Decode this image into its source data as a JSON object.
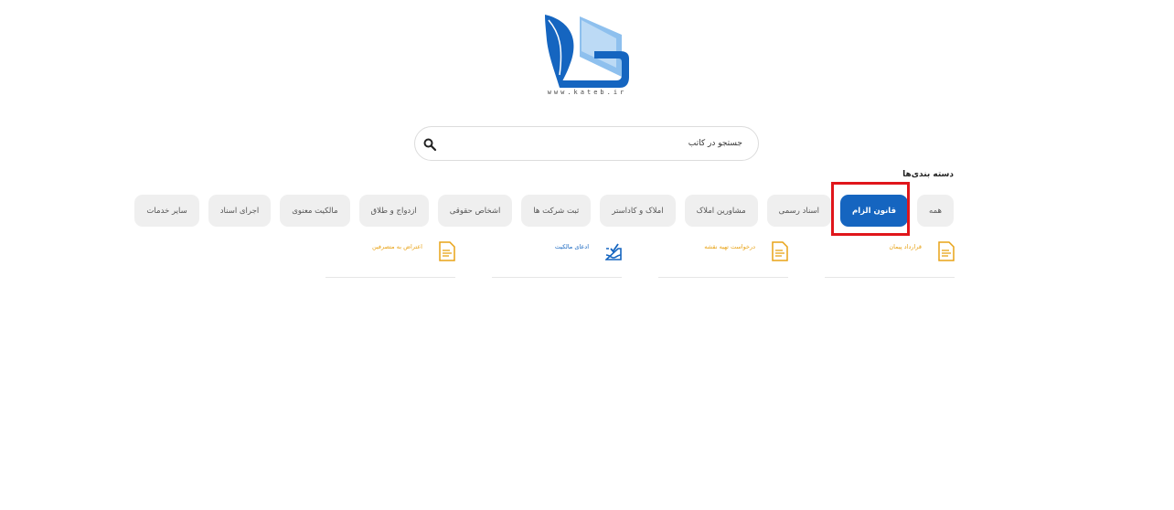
{
  "brand": {
    "url": "www.kateb.ir",
    "colors": {
      "primary": "#1565c0",
      "accent_light": "#8ec0ee",
      "doc_icon": "#e8a317",
      "highlight": "#e0161b"
    }
  },
  "search": {
    "placeholder": "جستجو در کاتب",
    "icon": "search-icon"
  },
  "categories": {
    "title": "دسته بندی‌ها",
    "items": [
      {
        "label": "همه",
        "active": false
      },
      {
        "label": "قانون الزام",
        "active": true
      },
      {
        "label": "اسناد رسمی",
        "active": false
      },
      {
        "label": "مشاورین املاک",
        "active": false
      },
      {
        "label": "املاک و کاداستر",
        "active": false
      },
      {
        "label": "ثبت شرکت ها",
        "active": false
      },
      {
        "label": "اشخاص حقوقی",
        "active": false
      },
      {
        "label": "ازدواج و طلاق",
        "active": false
      },
      {
        "label": "مالکیت معنوی",
        "active": false
      },
      {
        "label": "اجرای اسناد",
        "active": false
      },
      {
        "label": "سایر خدمات",
        "active": false
      }
    ]
  },
  "documents": [
    {
      "label": "قرارداد پیمان",
      "icon": "document-icon"
    },
    {
      "label": "درخواست تهیه نقشه",
      "icon": "document-icon"
    },
    {
      "label": "ادعای مالکیت",
      "icon": "inbox-check-icon"
    },
    {
      "label": "اعتراض به متصرفین",
      "icon": "document-icon"
    }
  ]
}
